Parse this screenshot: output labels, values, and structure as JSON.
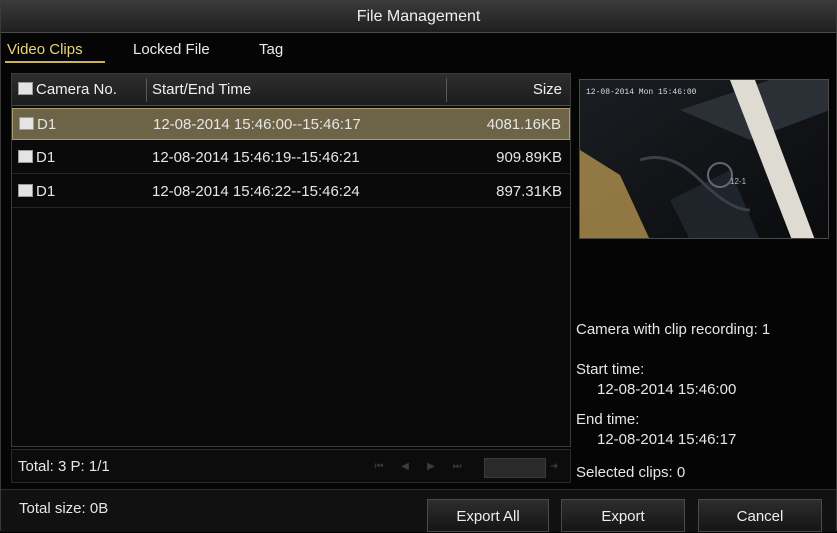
{
  "window": {
    "title": "File Management"
  },
  "tabs": [
    {
      "label": "Video Clips",
      "active": true
    },
    {
      "label": "Locked File",
      "active": false
    },
    {
      "label": "Tag",
      "active": false
    }
  ],
  "table": {
    "headers": {
      "camera": "Camera No.",
      "time": "Start/End Time",
      "size": "Size"
    },
    "rows": [
      {
        "camera": "D1",
        "time": "12-08-2014 15:46:00--15:46:17",
        "size": "4081.16KB",
        "selected": true
      },
      {
        "camera": "D1",
        "time": "12-08-2014 15:46:19--15:46:21",
        "size": "909.89KB",
        "selected": false
      },
      {
        "camera": "D1",
        "time": "12-08-2014 15:46:22--15:46:24",
        "size": "897.31KB",
        "selected": false
      }
    ]
  },
  "status": {
    "total_pages": "Total: 3  P: 1/1",
    "total_size": "Total size: 0B"
  },
  "pager": {
    "icons": [
      "first-page-icon",
      "prev-page-icon",
      "next-page-icon",
      "last-page-icon",
      "go-page-icon"
    ]
  },
  "preview": {
    "osd_text": "12-08-2014 Mon 15:46:00",
    "cam_label": "12-1"
  },
  "info": {
    "camera_recording": "Camera with clip recording: 1",
    "start_label": "Start time:",
    "start_value": "12-08-2014 15:46:00",
    "end_label": "End time:",
    "end_value": "12-08-2014 15:46:17",
    "selected": "Selected clips: 0"
  },
  "buttons": {
    "export_all": "Export All",
    "export": "Export",
    "cancel": "Cancel"
  },
  "colors": {
    "accent": "#e8d37a",
    "selected_row": "#6d6346"
  }
}
